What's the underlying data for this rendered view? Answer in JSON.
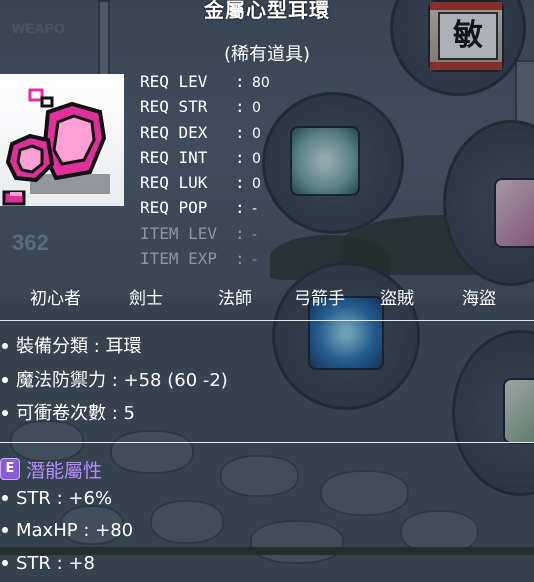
{
  "item": {
    "name": "金屬心型耳環",
    "rarity": "(稀有道具)"
  },
  "requirements": [
    {
      "label": "REQ LEV",
      "sep": ":",
      "value": "80",
      "dim": false
    },
    {
      "label": "REQ STR",
      "sep": ":",
      "value": "0",
      "dim": false
    },
    {
      "label": "REQ DEX",
      "sep": ":",
      "value": "0",
      "dim": false
    },
    {
      "label": "REQ INT",
      "sep": ":",
      "value": "0",
      "dim": false
    },
    {
      "label": "REQ LUK",
      "sep": ":",
      "value": "0",
      "dim": false
    },
    {
      "label": "REQ POP",
      "sep": ":",
      "value": "-",
      "dim": false
    },
    {
      "label": "ITEM LEV",
      "sep": ":",
      "value": "-",
      "dim": true
    },
    {
      "label": "ITEM EXP",
      "sep": ":",
      "value": "-",
      "dim": true
    }
  ],
  "jobs": [
    "初心者",
    "劍士",
    "法師",
    "弓箭手",
    "盜賊",
    "海盜"
  ],
  "stats": [
    "裝備分類 : 耳環",
    "魔法防禦力 : +58 (60 -2)",
    "可衝卷次數 : 5"
  ],
  "potential": {
    "badge": "E",
    "label": "潛能屬性",
    "lines": [
      "STR : +6%",
      "MaxHP : +80",
      "STR : +8"
    ]
  },
  "background": {
    "partial_text": "WEAPO",
    "number_text": "362"
  },
  "colors": {
    "potential_accent": "#b48cff",
    "badge": "#8a5bd6",
    "icon_pink": "#e0309a"
  },
  "icons": {
    "item": "heart-earring-icon",
    "skills": [
      "agility-scroll-icon",
      "wind-skill-icon",
      "slash-skill-icon",
      "swirl-skill-icon",
      "paper-skill-icon"
    ]
  }
}
